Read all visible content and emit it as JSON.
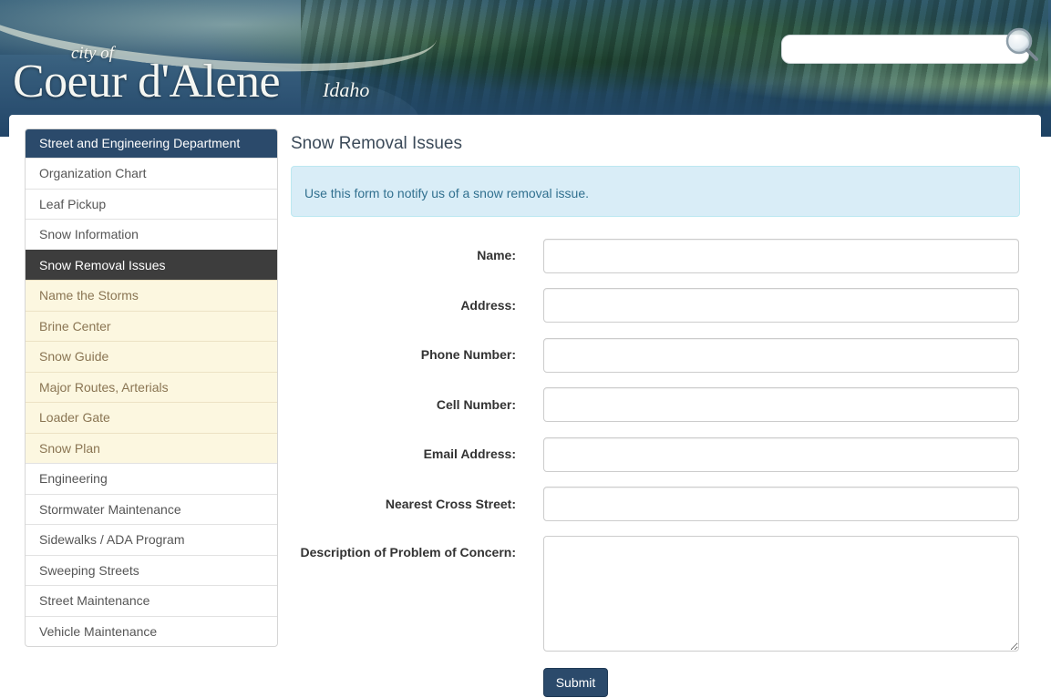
{
  "header": {
    "logo": {
      "city_of": "city of",
      "name": "Coeur d'Alene",
      "state": "Idaho"
    },
    "search": {
      "placeholder": ""
    }
  },
  "sidebar": {
    "title": "Street and Engineering Department",
    "items": [
      {
        "label": "Organization Chart"
      },
      {
        "label": "Leaf Pickup"
      },
      {
        "label": "Snow Information"
      },
      {
        "label": "Snow Removal Issues"
      },
      {
        "label": "Name the Storms"
      },
      {
        "label": "Brine Center"
      },
      {
        "label": "Snow Guide"
      },
      {
        "label": "Major Routes, Arterials"
      },
      {
        "label": "Loader Gate"
      },
      {
        "label": "Snow Plan"
      },
      {
        "label": "Engineering"
      },
      {
        "label": "Stormwater Maintenance"
      },
      {
        "label": "Sidewalks / ADA Program"
      },
      {
        "label": "Sweeping Streets"
      },
      {
        "label": "Street Maintenance"
      },
      {
        "label": "Vehicle Maintenance"
      }
    ]
  },
  "main": {
    "title": "Snow Removal Issues",
    "info": "Use this form to notify us of a snow removal issue.",
    "form": {
      "name_label": "Name:",
      "address_label": "Address:",
      "phone_label": "Phone Number:",
      "cell_label": "Cell Number:",
      "email_label": "Email Address:",
      "cross_street_label": "Nearest Cross Street:",
      "description_label": "Description of Problem of Concern:",
      "submit_label": "Submit"
    }
  },
  "colors": {
    "nav_header": "#2b4a6b",
    "nav_active": "#3d3d3d",
    "nav_sub_background": "#fcf7e0",
    "nav_sub_text": "#8a7553",
    "info_background": "#d9edf7",
    "info_text": "#31708f",
    "submit_button": "#2b4a6b"
  }
}
